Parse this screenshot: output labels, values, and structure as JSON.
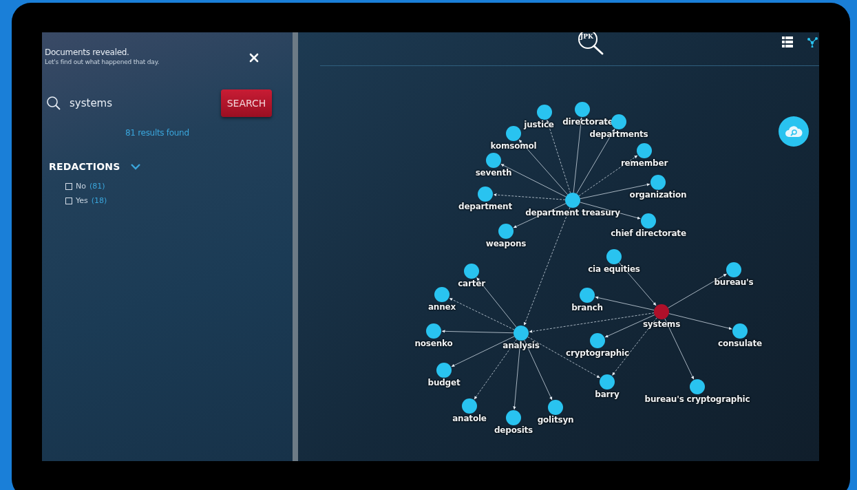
{
  "intro": {
    "title": "Documents revealed.",
    "subtitle": "Let's find out what happened that day."
  },
  "search": {
    "value": "systems",
    "button": "SEARCH",
    "results": "81 results found"
  },
  "filter": {
    "title": "REDACTIONS",
    "expanded": true,
    "options": [
      {
        "label": "No",
        "count": "(81)",
        "checked": false
      },
      {
        "label": "Yes",
        "count": "(18)",
        "checked": false
      }
    ]
  },
  "logo": {
    "text": "JPK"
  },
  "graph": {
    "nodes": [
      {
        "label": "directorate",
        "color": "#29c3f0"
      },
      {
        "label": "justice",
        "color": "#29c3f0"
      },
      {
        "label": "departments",
        "color": "#29c3f0"
      },
      {
        "label": "komsomol",
        "color": "#29c3f0"
      },
      {
        "label": "remember",
        "color": "#29c3f0"
      },
      {
        "label": "seventh",
        "color": "#29c3f0"
      },
      {
        "label": "organization",
        "color": "#29c3f0"
      },
      {
        "label": "department",
        "color": "#29c3f0"
      },
      {
        "label": "department treasury",
        "color": "#29c3f0"
      },
      {
        "label": "chief directorate",
        "color": "#29c3f0"
      },
      {
        "label": "weapons",
        "color": "#29c3f0"
      },
      {
        "label": "cia equities",
        "color": "#29c3f0"
      },
      {
        "label": "bureau's",
        "color": "#29c3f0"
      },
      {
        "label": "carter",
        "color": "#29c3f0"
      },
      {
        "label": "annex",
        "color": "#29c3f0"
      },
      {
        "label": "branch",
        "color": "#29c3f0"
      },
      {
        "label": "systems",
        "color": "#b0102a"
      },
      {
        "label": "nosenko",
        "color": "#29c3f0"
      },
      {
        "label": "analysis",
        "color": "#29c3f0"
      },
      {
        "label": "consulate",
        "color": "#29c3f0"
      },
      {
        "label": "cryptographic",
        "color": "#29c3f0"
      },
      {
        "label": "budget",
        "color": "#29c3f0"
      },
      {
        "label": "barry",
        "color": "#29c3f0"
      },
      {
        "label": "bureau's cryptographic",
        "color": "#29c3f0"
      },
      {
        "label": "anatole",
        "color": "#29c3f0"
      },
      {
        "label": "golitsyn",
        "color": "#29c3f0"
      },
      {
        "label": "deposits",
        "color": "#29c3f0"
      }
    ]
  }
}
